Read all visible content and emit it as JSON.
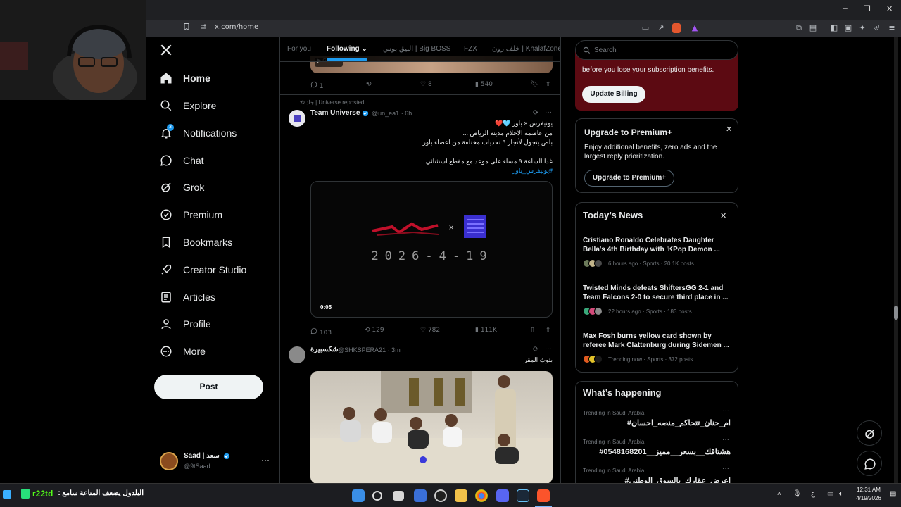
{
  "browser": {
    "url": "x.com/home",
    "win_min": "─",
    "win_max": "❐",
    "win_close": "✕"
  },
  "nav": {
    "items": [
      {
        "label": "Home"
      },
      {
        "label": "Explore"
      },
      {
        "label": "Notifications"
      },
      {
        "label": "Chat"
      },
      {
        "label": "Grok"
      },
      {
        "label": "Premium"
      },
      {
        "label": "Bookmarks"
      },
      {
        "label": "Creator Studio"
      },
      {
        "label": "Articles"
      },
      {
        "label": "Profile"
      },
      {
        "label": "More"
      }
    ],
    "notif_badge": "3",
    "post_label": "Post",
    "account": {
      "name": "Saad | سعد",
      "handle": "@9tSaad"
    }
  },
  "feed": {
    "tabs": [
      "For you",
      "Following",
      "البيق بوس | Big BOSS",
      "FZX",
      "خلف زون | KhalafZone"
    ],
    "prev_post_actions": {
      "replies": "1",
      "likes": "8",
      "views": "540"
    },
    "post1": {
      "repost_note": "جاد | Universe reposted",
      "name": "Team Universe",
      "handle": "@un_ea1",
      "time": "· 6h",
      "lines": [
        "يونيفرس × باور 🩵❤️ ..",
        "من عاصمة الاحلام مدينة الرياض ...",
        "باص يتجول لأنجاز ٦ تحديات مختلفة من اعضاء باور",
        "",
        "غدا الساعة ٩ مساء على موعد مع مقطع استثنائي .",
        "#يونيفرس_باور"
      ],
      "video_date": "2026-4-19",
      "video_time": "0:05",
      "replies": "103",
      "reposts": "129",
      "likes": "782",
      "views": "111K"
    },
    "post2": {
      "name": "شكسبيرة",
      "handle": "@SHKSPERA21",
      "time": "· 3m",
      "text": "بثوث المقر"
    }
  },
  "sidebar": {
    "search_placeholder": "Search",
    "billing": {
      "text": "before you lose your subscription benefits.",
      "button": "Update Billing"
    },
    "premium": {
      "title": "Upgrade to Premium+",
      "body": "Enjoy additional benefits, zero ads and the largest reply prioritization.",
      "button": "Upgrade to Premium+"
    },
    "news": {
      "title": "Today’s News",
      "items": [
        {
          "title": "Cristiano Ronaldo Celebrates Daughter Bella's 4th Birthday with 'KPop Demon ...",
          "meta": "6 hours ago · Sports · 20.1K posts"
        },
        {
          "title": "Twisted Minds defeats ShiftersGG 2-1 and Team Falcons 2-0 to secure third place in ...",
          "meta": "22 hours ago · Sports · 183 posts"
        },
        {
          "title": "Max Fosh burns yellow card shown by referee Mark Clattenburg during Sidemen ...",
          "meta": "Trending now · Sports · 372 posts"
        }
      ]
    },
    "happening": {
      "title": "What’s happening",
      "items": [
        {
          "label": "Trending in Saudi Arabia",
          "value": "#ام_حنان_تتحاكم_منصه_احسان"
        },
        {
          "label": "Trending in Saudi Arabia",
          "value": "#هشتاقك__بسعر__مميز__0548168201"
        },
        {
          "label": "Trending in Saudi Arabia",
          "value": "#اعرض_عقارك_بالسوق_الوطني"
        }
      ]
    }
  },
  "taskbar": {
    "ticker": "r22td",
    "ticker_text": "البلدول يضعف المتاعة سامع :",
    "time": "12:31 AM",
    "date": "4/19/2026"
  },
  "colors": {
    "accent": "#1d9bf0",
    "billing_bg": "#5c0a12",
    "bg": "#000000",
    "border": "#2f3336",
    "muted": "#71767b"
  }
}
